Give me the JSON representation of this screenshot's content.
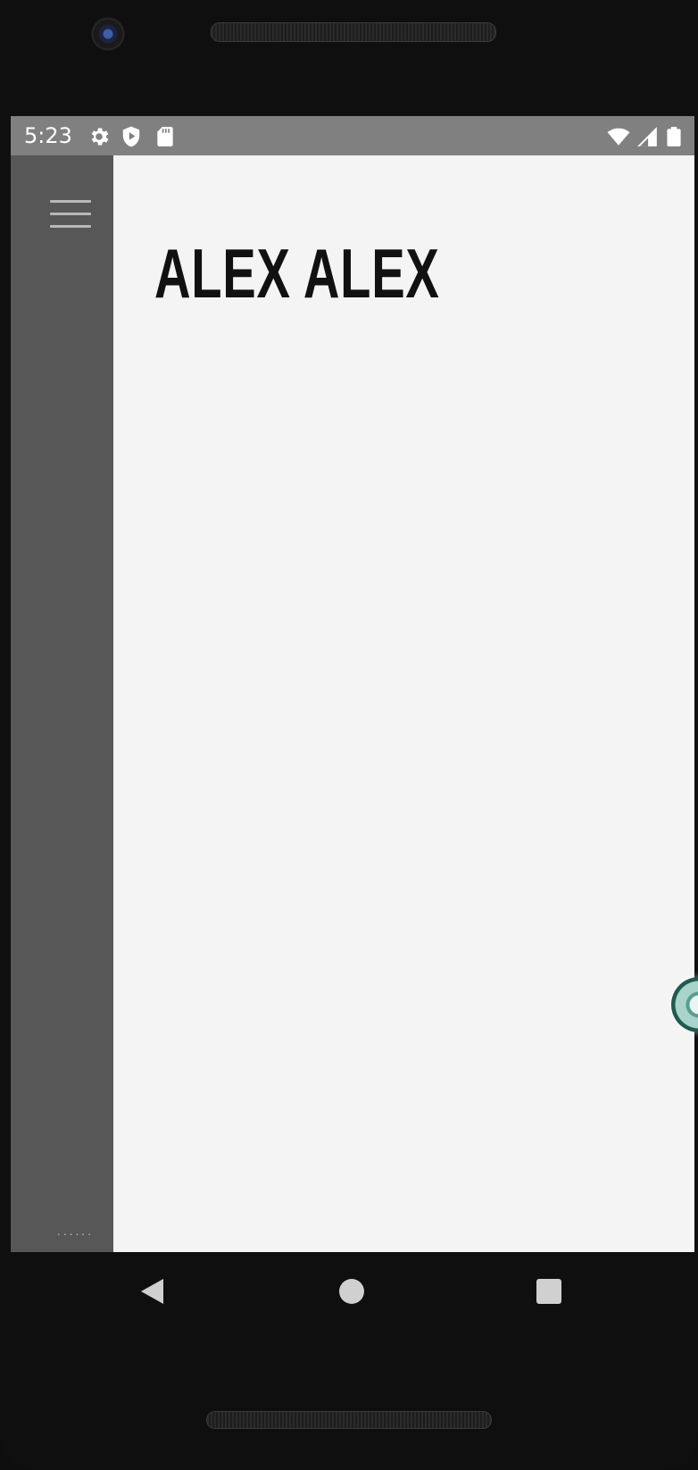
{
  "status_bar": {
    "time": "5:23",
    "left_icons": [
      "settings-icon",
      "play-shield-icon",
      "sd-card-icon"
    ],
    "right_icons": [
      "wifi-icon",
      "cell-signal-icon",
      "battery-icon"
    ],
    "background": "#808080"
  },
  "sidebar": {
    "menu_icon": "hamburger-menu-icon",
    "footer_text": "......",
    "background": "#575757"
  },
  "main": {
    "title": "ALEX ALEX",
    "background": "#f4f4f4"
  },
  "overlay": {
    "floating_button_icon": "assistant-bubble-icon"
  },
  "nav_bar": {
    "buttons": [
      "back-icon",
      "home-icon",
      "recents-icon"
    ]
  }
}
